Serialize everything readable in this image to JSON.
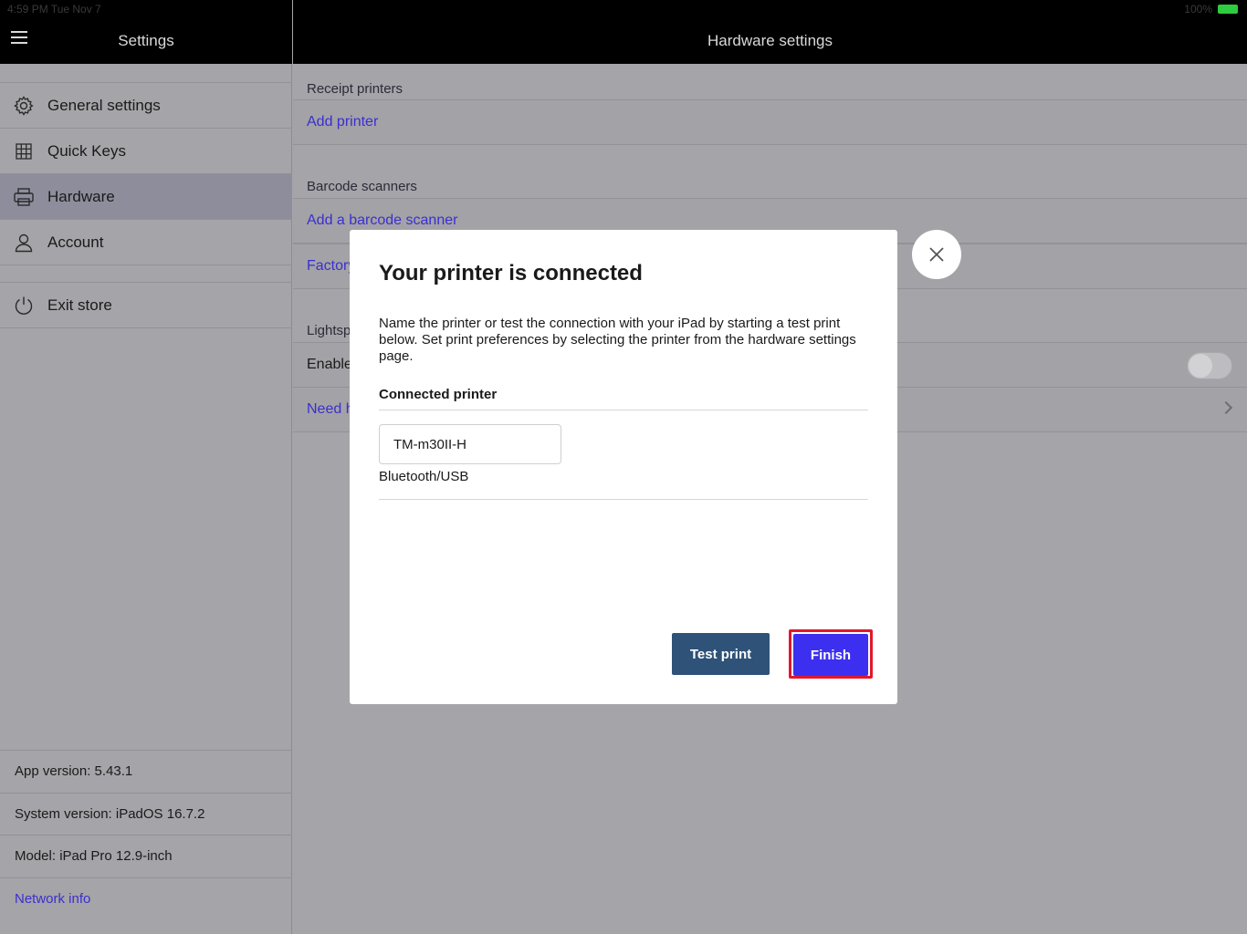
{
  "status_bar": {
    "time": "4:59 PM  Tue Nov 7",
    "battery": "100%"
  },
  "sidebar": {
    "title": "Settings",
    "items": [
      {
        "label": "General settings",
        "icon": "gear-icon"
      },
      {
        "label": "Quick Keys",
        "icon": "grid-icon"
      },
      {
        "label": "Hardware",
        "icon": "printer-icon",
        "active": true
      },
      {
        "label": "Account",
        "icon": "person-icon"
      }
    ],
    "exit_label": "Exit store",
    "info": {
      "app_version": "App version: 5.43.1",
      "system_version": "System version: iPadOS 16.7.2",
      "model": "Model: iPad Pro 12.9-inch",
      "network_info": "Network info"
    }
  },
  "main": {
    "title": "Hardware settings",
    "receipt_printers_title": "Receipt printers",
    "add_printer": "Add printer",
    "barcode_scanners_title": "Barcode scanners",
    "add_barcode_scanner": "Add a barcode scanner",
    "factory_row": "Factory",
    "lightspeed_title": "Lightsp",
    "enable_row": "Enable",
    "need_help_row": "Need h"
  },
  "modal": {
    "title": "Your printer is connected",
    "description": "Name the printer or test the connection with your iPad by starting a test print below. Set print preferences by selecting the printer from the hardware settings page.",
    "connected_label": "Connected printer",
    "printer_name": "TM-m30II-H",
    "connection_type": "Bluetooth/USB",
    "test_print": "Test print",
    "finish": "Finish"
  },
  "colors": {
    "accent": "#3c2ff0",
    "test_button": "#2e5278",
    "highlight": "#e0182d",
    "link": "#3b2fcf"
  }
}
